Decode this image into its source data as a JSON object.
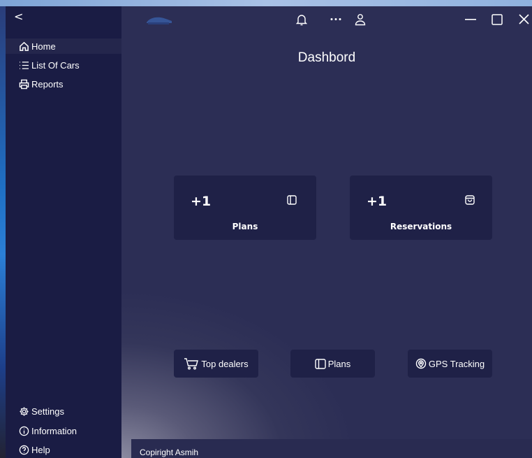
{
  "window": {
    "back_glyph": "<"
  },
  "sidebar": {
    "items": [
      {
        "label": "Home",
        "icon": "home-icon"
      },
      {
        "label": "List Of Cars",
        "icon": "list-icon"
      },
      {
        "label": "Reports",
        "icon": "printer-icon"
      }
    ],
    "bottom_items": [
      {
        "label": "Settings",
        "icon": "gear-icon"
      },
      {
        "label": "Information",
        "icon": "info-icon"
      },
      {
        "label": "Help",
        "icon": "help-icon"
      }
    ]
  },
  "header": {
    "title": "Dashbord"
  },
  "cards": [
    {
      "value": "+1",
      "label": "Plans",
      "icon": "panel-icon"
    },
    {
      "value": "+1",
      "label": "Reservations",
      "icon": "bag-icon"
    }
  ],
  "buttons": [
    {
      "label": "Top dealers",
      "icon": "cart-icon"
    },
    {
      "label": "Plans",
      "icon": "panel-icon"
    },
    {
      "label": "GPS Tracking",
      "icon": "location-icon"
    }
  ],
  "footer": {
    "text": "Copiright Asmih"
  },
  "colors": {
    "sidebar": "#1a1c44",
    "main": "#2c2e55",
    "card": "#1f2147",
    "accent": "#7ea4d6"
  }
}
